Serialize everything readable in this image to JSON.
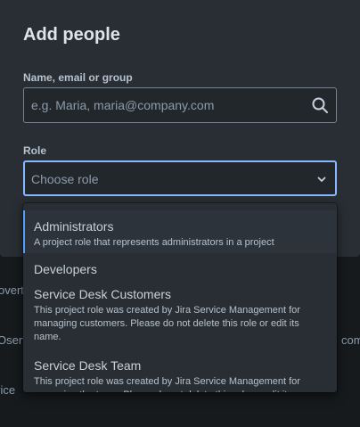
{
  "modal": {
    "title": "Add people",
    "name_label": "Name, email or group",
    "name_placeholder": "e.g. Maria, maria@company.com",
    "role_label": "Role",
    "role_value": "Choose role"
  },
  "dropdown": {
    "options": [
      {
        "label": "Administrators",
        "description": "A project role that represents administrators in a project",
        "selected": true
      },
      {
        "label": "Developers",
        "description": ""
      },
      {
        "label": "Service Desk Customers",
        "description": "This project role was created by Jira Service Management for managing customers. Please do not delete this role or edit its name."
      },
      {
        "label": "Service Desk Team",
        "description": "This project role was created by Jira Service Management for managing the team. Please do not delete this role or edit its name."
      }
    ]
  },
  "background": {
    "text_1": "overt",
    "text_2": "Oserv",
    "text_3": "com",
    "text_4": "vice"
  },
  "colors": {
    "focus_border": "#85b8ff",
    "selected_indicator": "#579dff",
    "modal_bg": "#282e33"
  }
}
